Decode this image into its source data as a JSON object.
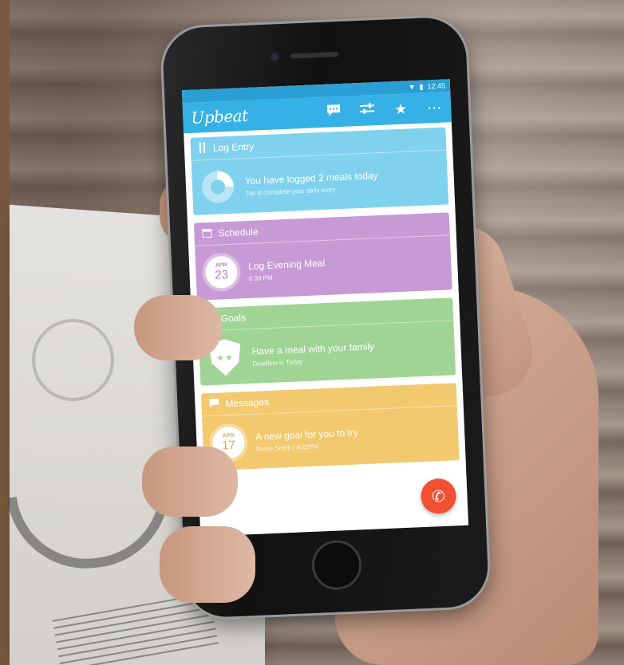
{
  "status_bar": {
    "time": "12:45"
  },
  "app_bar": {
    "logo": "Upbeat",
    "icons": [
      "chat-icon",
      "sliders-icon",
      "star-icon",
      "more-icon"
    ]
  },
  "cards": {
    "log_entry": {
      "header": "Log Entry",
      "title": "You have logged 2 meals today",
      "subtitle": "Tap to complete your daily entry",
      "progress_fraction": 0.25
    },
    "schedule": {
      "header": "Schedule",
      "month": "APR",
      "day": "23",
      "title": "Log Evening Meal",
      "subtitle": "6:30 PM"
    },
    "goals": {
      "header": "Goals",
      "title": "Have a meal with your family",
      "subtitle": "Deadline is Today"
    },
    "messages": {
      "header": "Messages",
      "month": "APR",
      "day": "17",
      "title": "A new goal for you to try",
      "subtitle": "Nurse Smith | 4:22PM"
    }
  },
  "colors": {
    "app_bar": "#35b1e6",
    "log_entry": "#7fd1ee",
    "schedule": "#c79ad6",
    "goals": "#9fd494",
    "messages": "#f2c96e",
    "call_button": "#f15033"
  }
}
